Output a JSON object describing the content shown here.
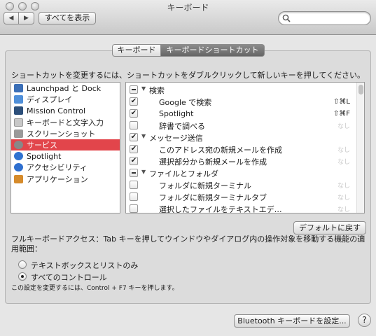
{
  "window": {
    "title": "キーボード"
  },
  "toolbar": {
    "back_label": "◀",
    "forward_label": "▶",
    "show_all_label": "すべてを表示",
    "search_placeholder": ""
  },
  "tabs": [
    {
      "label": "キーボード"
    },
    {
      "label": "キーボードショートカット"
    }
  ],
  "instruction": "ショートカットを変更するには、ショートカットをダブルクリックして新しいキーを押してください。",
  "categories": [
    {
      "label": "Launchpad と Dock",
      "icon": "launchpad-icon",
      "color": "#3b6fb7"
    },
    {
      "label": "ディスプレイ",
      "icon": "display-icon",
      "color": "#4f8fd9"
    },
    {
      "label": "Mission Control",
      "icon": "mission-control-icon",
      "color": "#2c4f7a"
    },
    {
      "label": "キーボードと文字入力",
      "icon": "keyboard-icon",
      "color": "#c8c8c8"
    },
    {
      "label": "スクリーンショット",
      "icon": "screenshot-icon",
      "color": "#9a9a9a"
    },
    {
      "label": "サービス",
      "icon": "services-gear-icon",
      "color": "#888888",
      "selected": true
    },
    {
      "label": "Spotlight",
      "icon": "spotlight-icon",
      "color": "#2f72d0"
    },
    {
      "label": "アクセシビリティ",
      "icon": "accessibility-icon",
      "color": "#2e6fcf"
    },
    {
      "label": "アプリケーション",
      "icon": "applications-icon",
      "color": "#d68b2b"
    }
  ],
  "shortcuts": [
    {
      "type": "group",
      "label": "検索",
      "check": "mixed"
    },
    {
      "type": "item",
      "label": "Google で検索",
      "check": true,
      "key": "⇧⌘L",
      "dim": false
    },
    {
      "type": "item",
      "label": "Spotlight",
      "check": true,
      "key": "⇧⌘F",
      "dim": false
    },
    {
      "type": "item",
      "label": "辞書で調べる",
      "check": false,
      "key": "なし",
      "dim": true
    },
    {
      "type": "group",
      "label": "メッセージ送信",
      "check": true
    },
    {
      "type": "item",
      "label": "このアドレス宛の新規メールを作成",
      "check": true,
      "key": "なし",
      "dim": true
    },
    {
      "type": "item",
      "label": "選択部分から新規メールを作成",
      "check": true,
      "key": "なし",
      "dim": true
    },
    {
      "type": "group",
      "label": "ファイルとフォルダ",
      "check": "mixed"
    },
    {
      "type": "item",
      "label": "フォルダに新規ターミナル",
      "check": false,
      "key": "なし",
      "dim": true
    },
    {
      "type": "item",
      "label": "フォルダに新規ターミナルタブ",
      "check": false,
      "key": "なし",
      "dim": true
    },
    {
      "type": "item",
      "label": "選択したファイルをテキストエデ…",
      "check": false,
      "key": "なし",
      "dim": true
    }
  ],
  "default_button": "デフォルトに戻す",
  "full_keyboard_access": {
    "label": "フルキーボードアクセス：Tab キーを押してウインドウやダイアログ内の操作対象を移動する機能の適用範囲：",
    "options": [
      {
        "label": "テキストボックスとリストのみ",
        "selected": false
      },
      {
        "label": "すべてのコントロール",
        "selected": true
      }
    ],
    "note": "この設定を変更するには、Control + F7 キーを押します。"
  },
  "bluetooth_button": "Bluetooth キーボードを設定...",
  "help_label": "?"
}
